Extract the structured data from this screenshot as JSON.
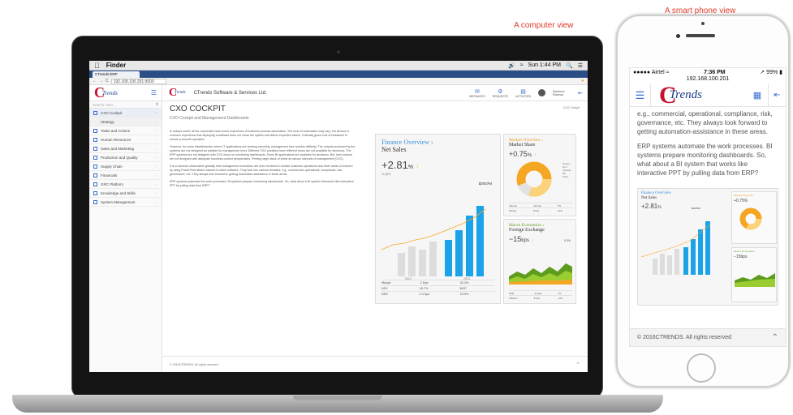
{
  "captions": {
    "computer": "A computer view",
    "phone": "A smart phone view"
  },
  "mac": {
    "app": "Finder",
    "clock": "Sun 1:44 PM"
  },
  "browser": {
    "tab": "CTrends ERP",
    "url": "192.168.100.201:9000"
  },
  "app": {
    "logo": "Trends",
    "company": "CTrends Software & Services Ltd.",
    "header_icons": [
      "MESSAGES",
      "REQUESTS",
      "ACTIVITIES"
    ],
    "user": "Mahfuzur Rahman",
    "search_placeholder": "Search Here...",
    "sidebar": [
      {
        "label": "CXO Cockpit"
      },
      {
        "label": "Strategy"
      },
      {
        "label": "Tasks and Actions"
      },
      {
        "label": "Human Resources"
      },
      {
        "label": "Sales and Marketing"
      },
      {
        "label": "Production and Quality"
      },
      {
        "label": "Supply Chain"
      },
      {
        "label": "Financials"
      },
      {
        "label": "GRC Platform"
      },
      {
        "label": "Knowledge and Skills"
      },
      {
        "label": "System Management"
      }
    ],
    "page_title": "CXO COCKPIT",
    "page_subtitle": "CXO Cockpit and Management Dashboards",
    "page_tag": "CXO Cockpit",
    "paragraphs": [
      "In today's world, all the corporates have some experience of business process automation. The level of automation may vary, but all have a common experience that deploying a software does not mean the system will deliver expected values. It literally gives a lot of headache to ensure a smooth operation.",
      "However, for some dissatisfaction where IT applications are working smoothly, management face another difficulty. The outputs produced by the systems are not designed as suitable for management level. Different CXO positions have different views are not available for decisions. The ERP systems are not designed with CXO focus on monitoring dashboards. Some BI applications are available for decisions. But, their outputs are not designed with adequate business context perspectives. Printing large stack of sheet at various intervals of management (CXO).",
      "It is a common observation globally that management executives are more inclined to monitor business operations and other areas of concern by using PowerPoint slides instead of online software. They look into various domains, e.g., commercial, operational, compliance, risk, governance, etc. They always look forward to getting automation-assistance in these areas.",
      "ERP systems automate the work processes. BI systems prepare monitoring dashboards. So, what about a BI system that works like interactive PPT by pulling data from ERP?"
    ],
    "footer": "© 2016CTRENDS. All rights reserved"
  },
  "finance": {
    "title": "Finance Overview",
    "metric": "Net Sales",
    "pct": "+2.81",
    "pct_unit": "%",
    "amount": "$2937M",
    "note": "To QR1",
    "years": [
      "2012",
      "2013"
    ],
    "rows": [
      [
        "Margin",
        "-2 Bps",
        "42.3%"
      ],
      [
        "NSV",
        "18.7%",
        "$437"
      ],
      [
        "NNV",
        "0.4 bps",
        "23.9%"
      ]
    ]
  },
  "market": {
    "title": "Market Overview",
    "metric": "Market Share",
    "pct": "+0.75",
    "pct_unit": "%",
    "legend": [
      "Oregon",
      "Red",
      "Pakistan",
      "BD",
      "Other"
    ],
    "rows": [
      [
        "Volume",
        "-16 bps",
        "7%"
      ],
      [
        "Pricing",
        "8 bps",
        "+2%"
      ]
    ]
  },
  "macro": {
    "title": "Macro Economics",
    "metric": "Foreign Exchange",
    "pct": "−15",
    "pct_unit": "bps",
    "side": "5.3%",
    "rows": [
      [
        "GDP",
        "-10 bps",
        "7%"
      ],
      [
        "Inflation",
        "8 bps",
        "+2%"
      ]
    ]
  },
  "phone": {
    "carrier": "Airtel",
    "time": "7:36 PM",
    "battery": "99%",
    "url": "192.168.100.201",
    "text": [
      "e.g., commercial, operational, compliance, risk, governance, etc. They always look forward to getting automation-assistance in these areas.",
      "ERP systems automate the work processes. BI systems prepare monitoring dashboards. So, what about a BI system that works like interactive PPT by pulling data from ERP?"
    ],
    "footer_brand": "CTRENDS",
    "footer": "© 2016CTRENDS. All rights reserved"
  }
}
